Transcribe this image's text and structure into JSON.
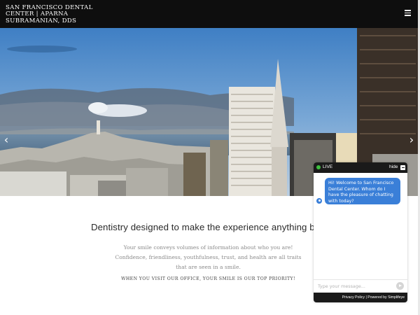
{
  "header": {
    "brand_lines": [
      "SAN FRANCISCO DENTAL",
      "CENTER | APARNA",
      "SUBRAMANIAN, DDS"
    ],
    "menu_icon": "hamburger-icon"
  },
  "hero": {
    "prev_icon": "‹",
    "next_icon": "›"
  },
  "intro": {
    "heading": "Dentistry designed to make the experience anything but ordinary",
    "body": "Your smile conveys volumes of information about who you are! Confidence, friendliness, youthfulness, trust, and health are all traits that are seen in a smile.",
    "priority": "WHEN YOU VISIT OUR OFFICE, YOUR SMILE IS OUR TOP PRIORITY!"
  },
  "chat": {
    "live_label": "LIVE",
    "hide_label": "hide",
    "welcome_message": "Hi! Welcome to San Francisco Dental Center. Whom do I have the pleasure of chatting with today?",
    "input_placeholder": "Type your message...",
    "footer_privacy": "Privacy Policy",
    "footer_separator": " | ",
    "footer_powered": "Powered by Simplifeye"
  },
  "colors": {
    "header_bg": "#0e0e0e",
    "chat_accent": "#3a7fd8",
    "live_green": "#3fbf3f"
  }
}
